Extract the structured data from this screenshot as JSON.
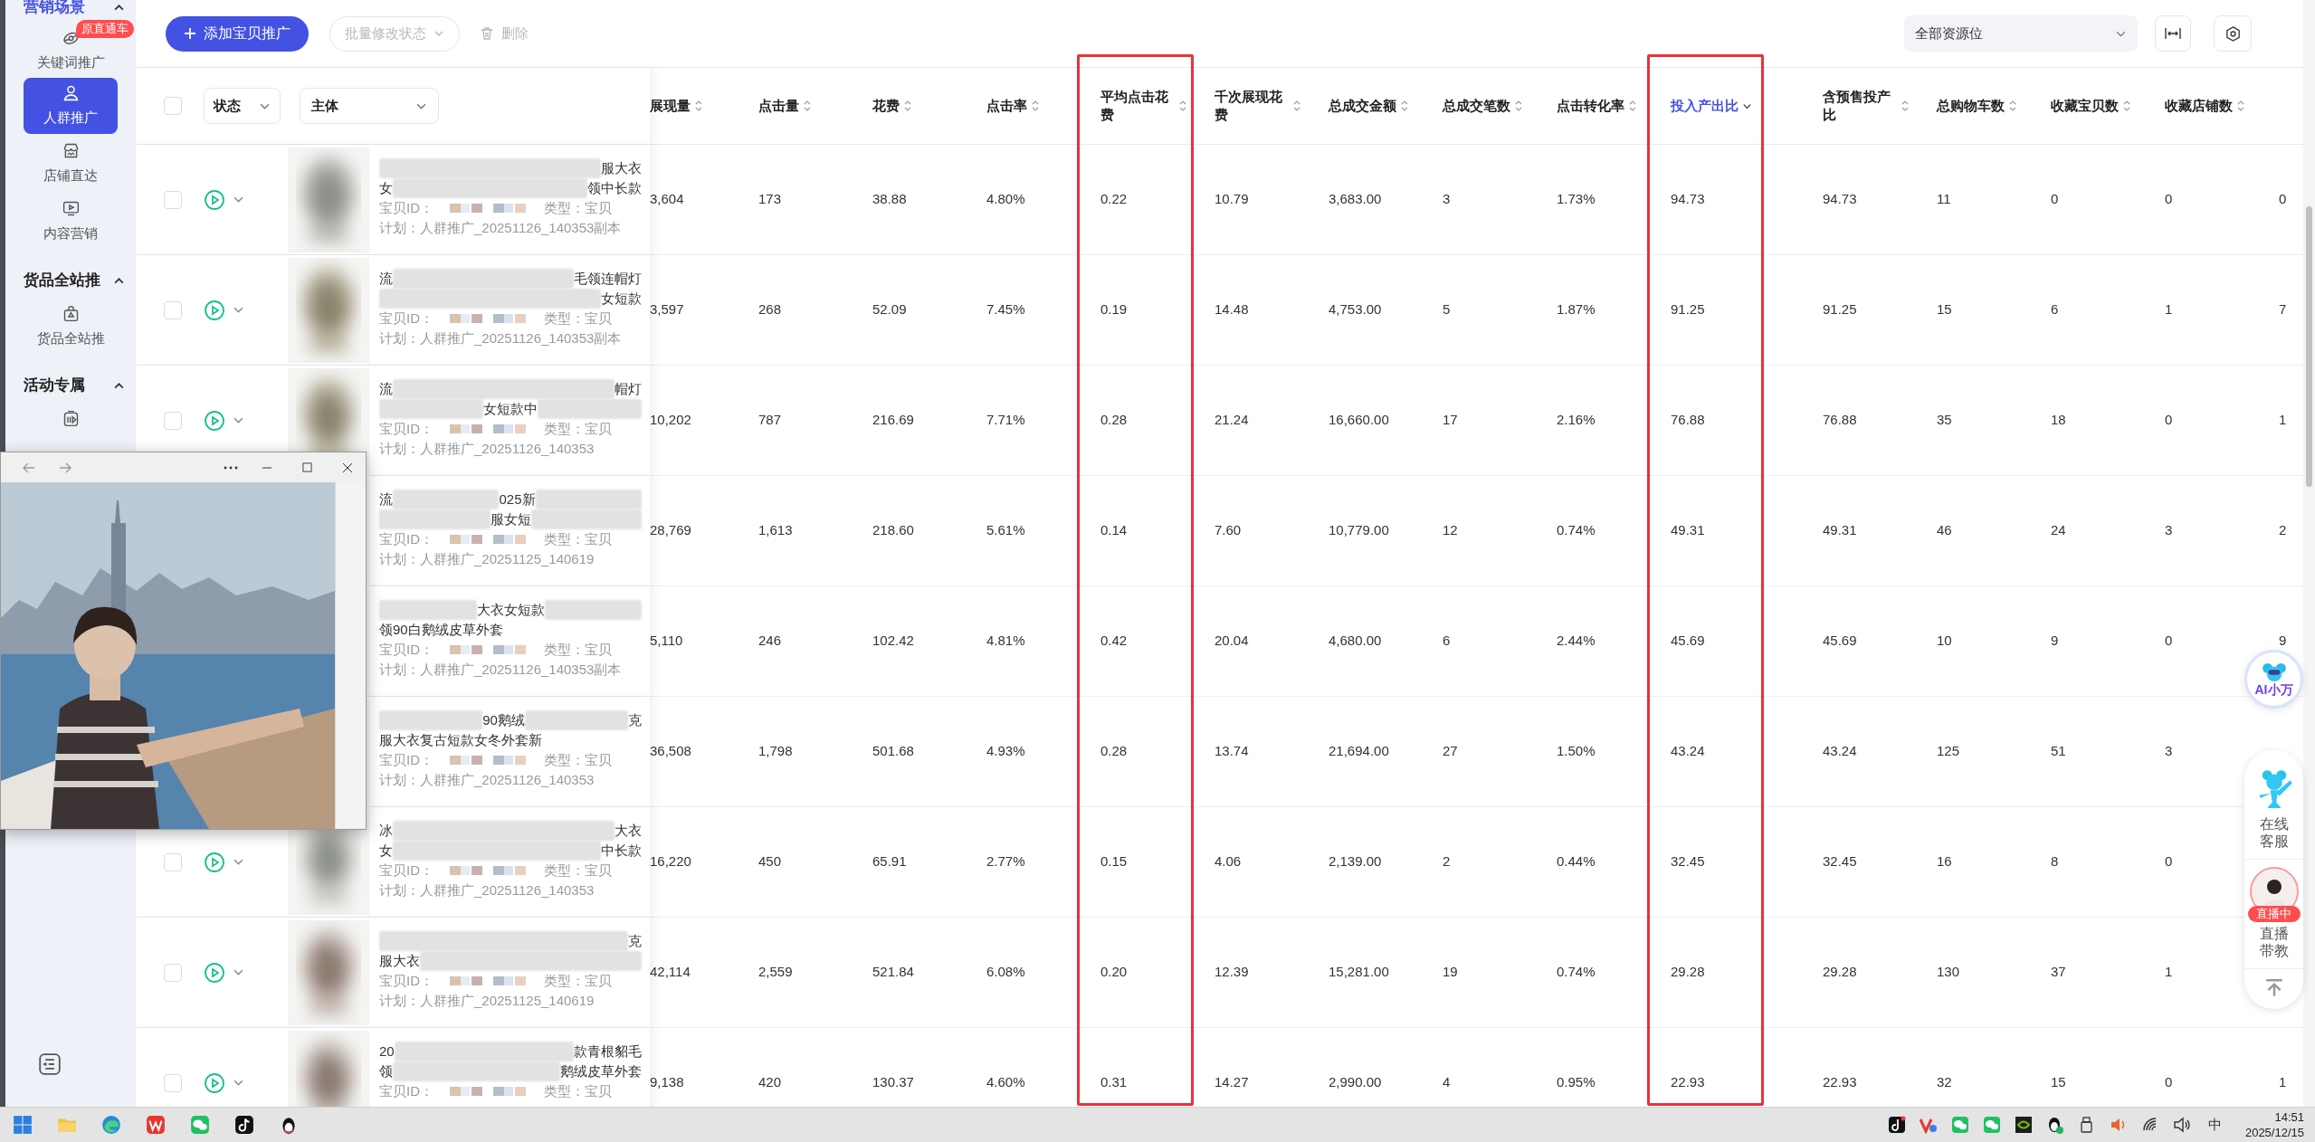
{
  "sidebar": {
    "sections": [
      {
        "title": "营销场景",
        "active": true,
        "expanded": true,
        "items": [
          {
            "label": "关键词推广",
            "badge": "原直通车",
            "selected": false
          },
          {
            "label": "人群推广",
            "selected": true
          },
          {
            "label": "店铺直达",
            "selected": false
          },
          {
            "label": "内容营销",
            "selected": false
          }
        ]
      },
      {
        "title": "货品全站推",
        "active": false,
        "expanded": true,
        "items": [
          {
            "label": "货品全站推",
            "selected": false
          }
        ]
      },
      {
        "title": "活动专属",
        "active": false,
        "expanded": true,
        "items": [
          {
            "selected": false
          }
        ]
      }
    ]
  },
  "toolbar": {
    "add_button": "添加宝贝推广",
    "batch_button": {
      "label": "批量修改状态",
      "disabled": true
    },
    "delete_button": {
      "label": "删除",
      "disabled": true
    },
    "resource_select": "全部资源位"
  },
  "table": {
    "select_all": {
      "checked": false
    },
    "filters": [
      "状态",
      "主体"
    ],
    "columns": [
      {
        "label": "展现量",
        "sorted": false,
        "highlighted": false
      },
      {
        "label": "点击量",
        "sorted": false,
        "highlighted": false
      },
      {
        "label": "花费",
        "sorted": false,
        "highlighted": false
      },
      {
        "label": "点击率",
        "sorted": false,
        "highlighted": false
      },
      {
        "label": "平均点击花费",
        "sorted": false,
        "highlighted": true
      },
      {
        "label": "千次展现花费",
        "sorted": false,
        "highlighted": false
      },
      {
        "label": "总成交金额",
        "sorted": false,
        "highlighted": false
      },
      {
        "label": "总成交笔数",
        "sorted": false,
        "highlighted": false
      },
      {
        "label": "点击转化率",
        "sorted": false,
        "highlighted": false
      },
      {
        "label": "投入产出比",
        "sorted": true,
        "highlighted": true
      },
      {
        "label": "含预售投产比",
        "sorted": false,
        "highlighted": false
      },
      {
        "label": "总购物车数",
        "sorted": false,
        "highlighted": false
      },
      {
        "label": "收藏宝贝数",
        "sorted": false,
        "highlighted": false
      },
      {
        "label": "收藏店铺数",
        "sorted": false,
        "highlighted": false
      }
    ],
    "rows": [
      {
        "checked": false,
        "title": [
          [
            {
              "kind": "blur"
            },
            {
              "kind": "text",
              "text": "服大衣"
            }
          ],
          [
            {
              "kind": "text",
              "text": "女"
            },
            {
              "kind": "blur"
            },
            {
              "kind": "text",
              "text": "领中长款"
            }
          ]
        ],
        "id_label": "宝贝ID：",
        "type": "类型：宝贝",
        "plan": "计划：人群推广_20251126_140353副本",
        "values": [
          "3,604",
          "173",
          "38.88",
          "4.80%",
          "0.22",
          "10.79",
          "3,683.00",
          "3",
          "1.73%",
          "94.73",
          "94.73",
          "11",
          "0",
          "0",
          "0"
        ]
      },
      {
        "checked": false,
        "title": [
          [
            {
              "kind": "text",
              "text": "流"
            },
            {
              "kind": "blur"
            },
            {
              "kind": "text",
              "text": "毛领连帽灯"
            }
          ],
          [
            {
              "kind": "blur"
            },
            {
              "kind": "text",
              "text": "女短款"
            }
          ]
        ],
        "id_label": "宝贝ID：",
        "type": "类型：宝贝",
        "plan": "计划：人群推广_20251126_140353副本",
        "values": [
          "3,597",
          "268",
          "52.09",
          "7.45%",
          "0.19",
          "14.48",
          "4,753.00",
          "5",
          "1.87%",
          "91.25",
          "91.25",
          "15",
          "6",
          "1",
          "7"
        ]
      },
      {
        "checked": false,
        "title": [
          [
            {
              "kind": "text",
              "text": "流"
            },
            {
              "kind": "blur"
            },
            {
              "kind": "text",
              "text": "帽灯"
            }
          ],
          [
            {
              "kind": "blur"
            },
            {
              "kind": "text",
              "text": "女短款中"
            },
            {
              "kind": "blur"
            }
          ]
        ],
        "id_label": "宝贝ID：",
        "type": "类型：宝贝",
        "plan": "计划：人群推广_20251126_140353",
        "values": [
          "10,202",
          "787",
          "216.69",
          "7.71%",
          "0.28",
          "21.24",
          "16,660.00",
          "17",
          "2.16%",
          "76.88",
          "76.88",
          "35",
          "18",
          "0",
          "1"
        ]
      },
      {
        "title": [
          [
            {
              "kind": "text",
              "text": "流"
            },
            {
              "kind": "blur"
            },
            {
              "kind": "text",
              "text": "025新"
            },
            {
              "kind": "blur"
            }
          ],
          [
            {
              "kind": "blur"
            },
            {
              "kind": "text",
              "text": "服女短"
            },
            {
              "kind": "blur"
            }
          ]
        ],
        "id_label": "宝贝ID：",
        "type": "类型：宝贝",
        "plan": "计划：人群推广_20251125_140619",
        "values": [
          "28,769",
          "1,613",
          "218.60",
          "5.61%",
          "0.14",
          "7.60",
          "10,779.00",
          "12",
          "0.74%",
          "49.31",
          "49.31",
          "46",
          "24",
          "3",
          "2"
        ]
      },
      {
        "title": [
          [
            {
              "kind": "blur"
            },
            {
              "kind": "text",
              "text": "大衣女短款"
            },
            {
              "kind": "blur"
            }
          ],
          [
            {
              "kind": "text",
              "text": "领90白鹅绒皮草外套"
            }
          ]
        ],
        "id_label": "宝贝ID：",
        "type": "类型：宝贝",
        "plan": "计划：人群推广_20251126_140353副本",
        "values": [
          "5,110",
          "246",
          "102.42",
          "4.81%",
          "0.42",
          "20.04",
          "4,680.00",
          "6",
          "2.44%",
          "45.69",
          "45.69",
          "10",
          "9",
          "0",
          "9"
        ]
      },
      {
        "title": [
          [
            {
              "kind": "blur"
            },
            {
              "kind": "text",
              "text": "90鹅绒"
            },
            {
              "kind": "blur"
            },
            {
              "kind": "text",
              "text": "克"
            }
          ],
          [
            {
              "kind": "text",
              "text": "服大衣复古短款女冬外套新"
            }
          ]
        ],
        "id_label": "宝贝ID：",
        "type": "类型：宝贝",
        "plan": "计划：人群推广_20251126_140353",
        "values": [
          "36,508",
          "1,798",
          "501.68",
          "4.93%",
          "0.28",
          "13.74",
          "21,694.00",
          "27",
          "1.50%",
          "43.24",
          "43.24",
          "125",
          "51",
          "3"
        ]
      },
      {
        "checked": false,
        "title": [
          [
            {
              "kind": "text",
              "text": "冰"
            },
            {
              "kind": "blur"
            },
            {
              "kind": "text",
              "text": "大衣"
            }
          ],
          [
            {
              "kind": "text",
              "text": "女"
            },
            {
              "kind": "blur"
            },
            {
              "kind": "text",
              "text": "中长款"
            }
          ]
        ],
        "id_label": "宝贝ID：",
        "type": "类型：宝贝",
        "plan": "计划：人群推广_20251126_140353",
        "values": [
          "16,220",
          "450",
          "65.91",
          "2.77%",
          "0.15",
          "4.06",
          "2,139.00",
          "2",
          "0.44%",
          "32.45",
          "32.45",
          "16",
          "8",
          "0"
        ]
      },
      {
        "checked": false,
        "title": [
          [
            {
              "kind": "blur"
            },
            {
              "kind": "text",
              "text": "克"
            }
          ],
          [
            {
              "kind": "text",
              "text": "服大衣"
            },
            {
              "kind": "blur"
            }
          ]
        ],
        "id_label": "宝贝ID：",
        "type": "类型：宝贝",
        "plan": "计划：人群推广_20251125_140619",
        "values": [
          "42,114",
          "2,559",
          "521.84",
          "6.08%",
          "0.20",
          "12.39",
          "15,281.00",
          "19",
          "0.74%",
          "29.28",
          "29.28",
          "130",
          "37",
          "1"
        ]
      },
      {
        "checked": false,
        "title": [
          [
            {
              "kind": "text",
              "text": "20"
            },
            {
              "kind": "blur"
            },
            {
              "kind": "text",
              "text": "款青根貂毛"
            }
          ],
          [
            {
              "kind": "text",
              "text": "领"
            },
            {
              "kind": "blur"
            },
            {
              "kind": "text",
              "text": "鹅绒皮草外套"
            }
          ]
        ],
        "id_label": "宝贝ID：",
        "type": "类型：宝贝",
        "values": [
          "9,138",
          "420",
          "130.37",
          "4.60%",
          "0.31",
          "14.27",
          "2,990.00",
          "4",
          "0.95%",
          "22.93",
          "22.93",
          "32",
          "15",
          "0",
          "1"
        ]
      }
    ]
  },
  "assistant": {
    "label": "AI小万"
  },
  "service_panel": {
    "items": [
      {
        "label": "在线客服"
      },
      {
        "label": "直播带教",
        "badge": "直播中"
      }
    ]
  },
  "taskbar": {
    "ime": "中",
    "time": "14:51",
    "date": "2025/12/15"
  }
}
